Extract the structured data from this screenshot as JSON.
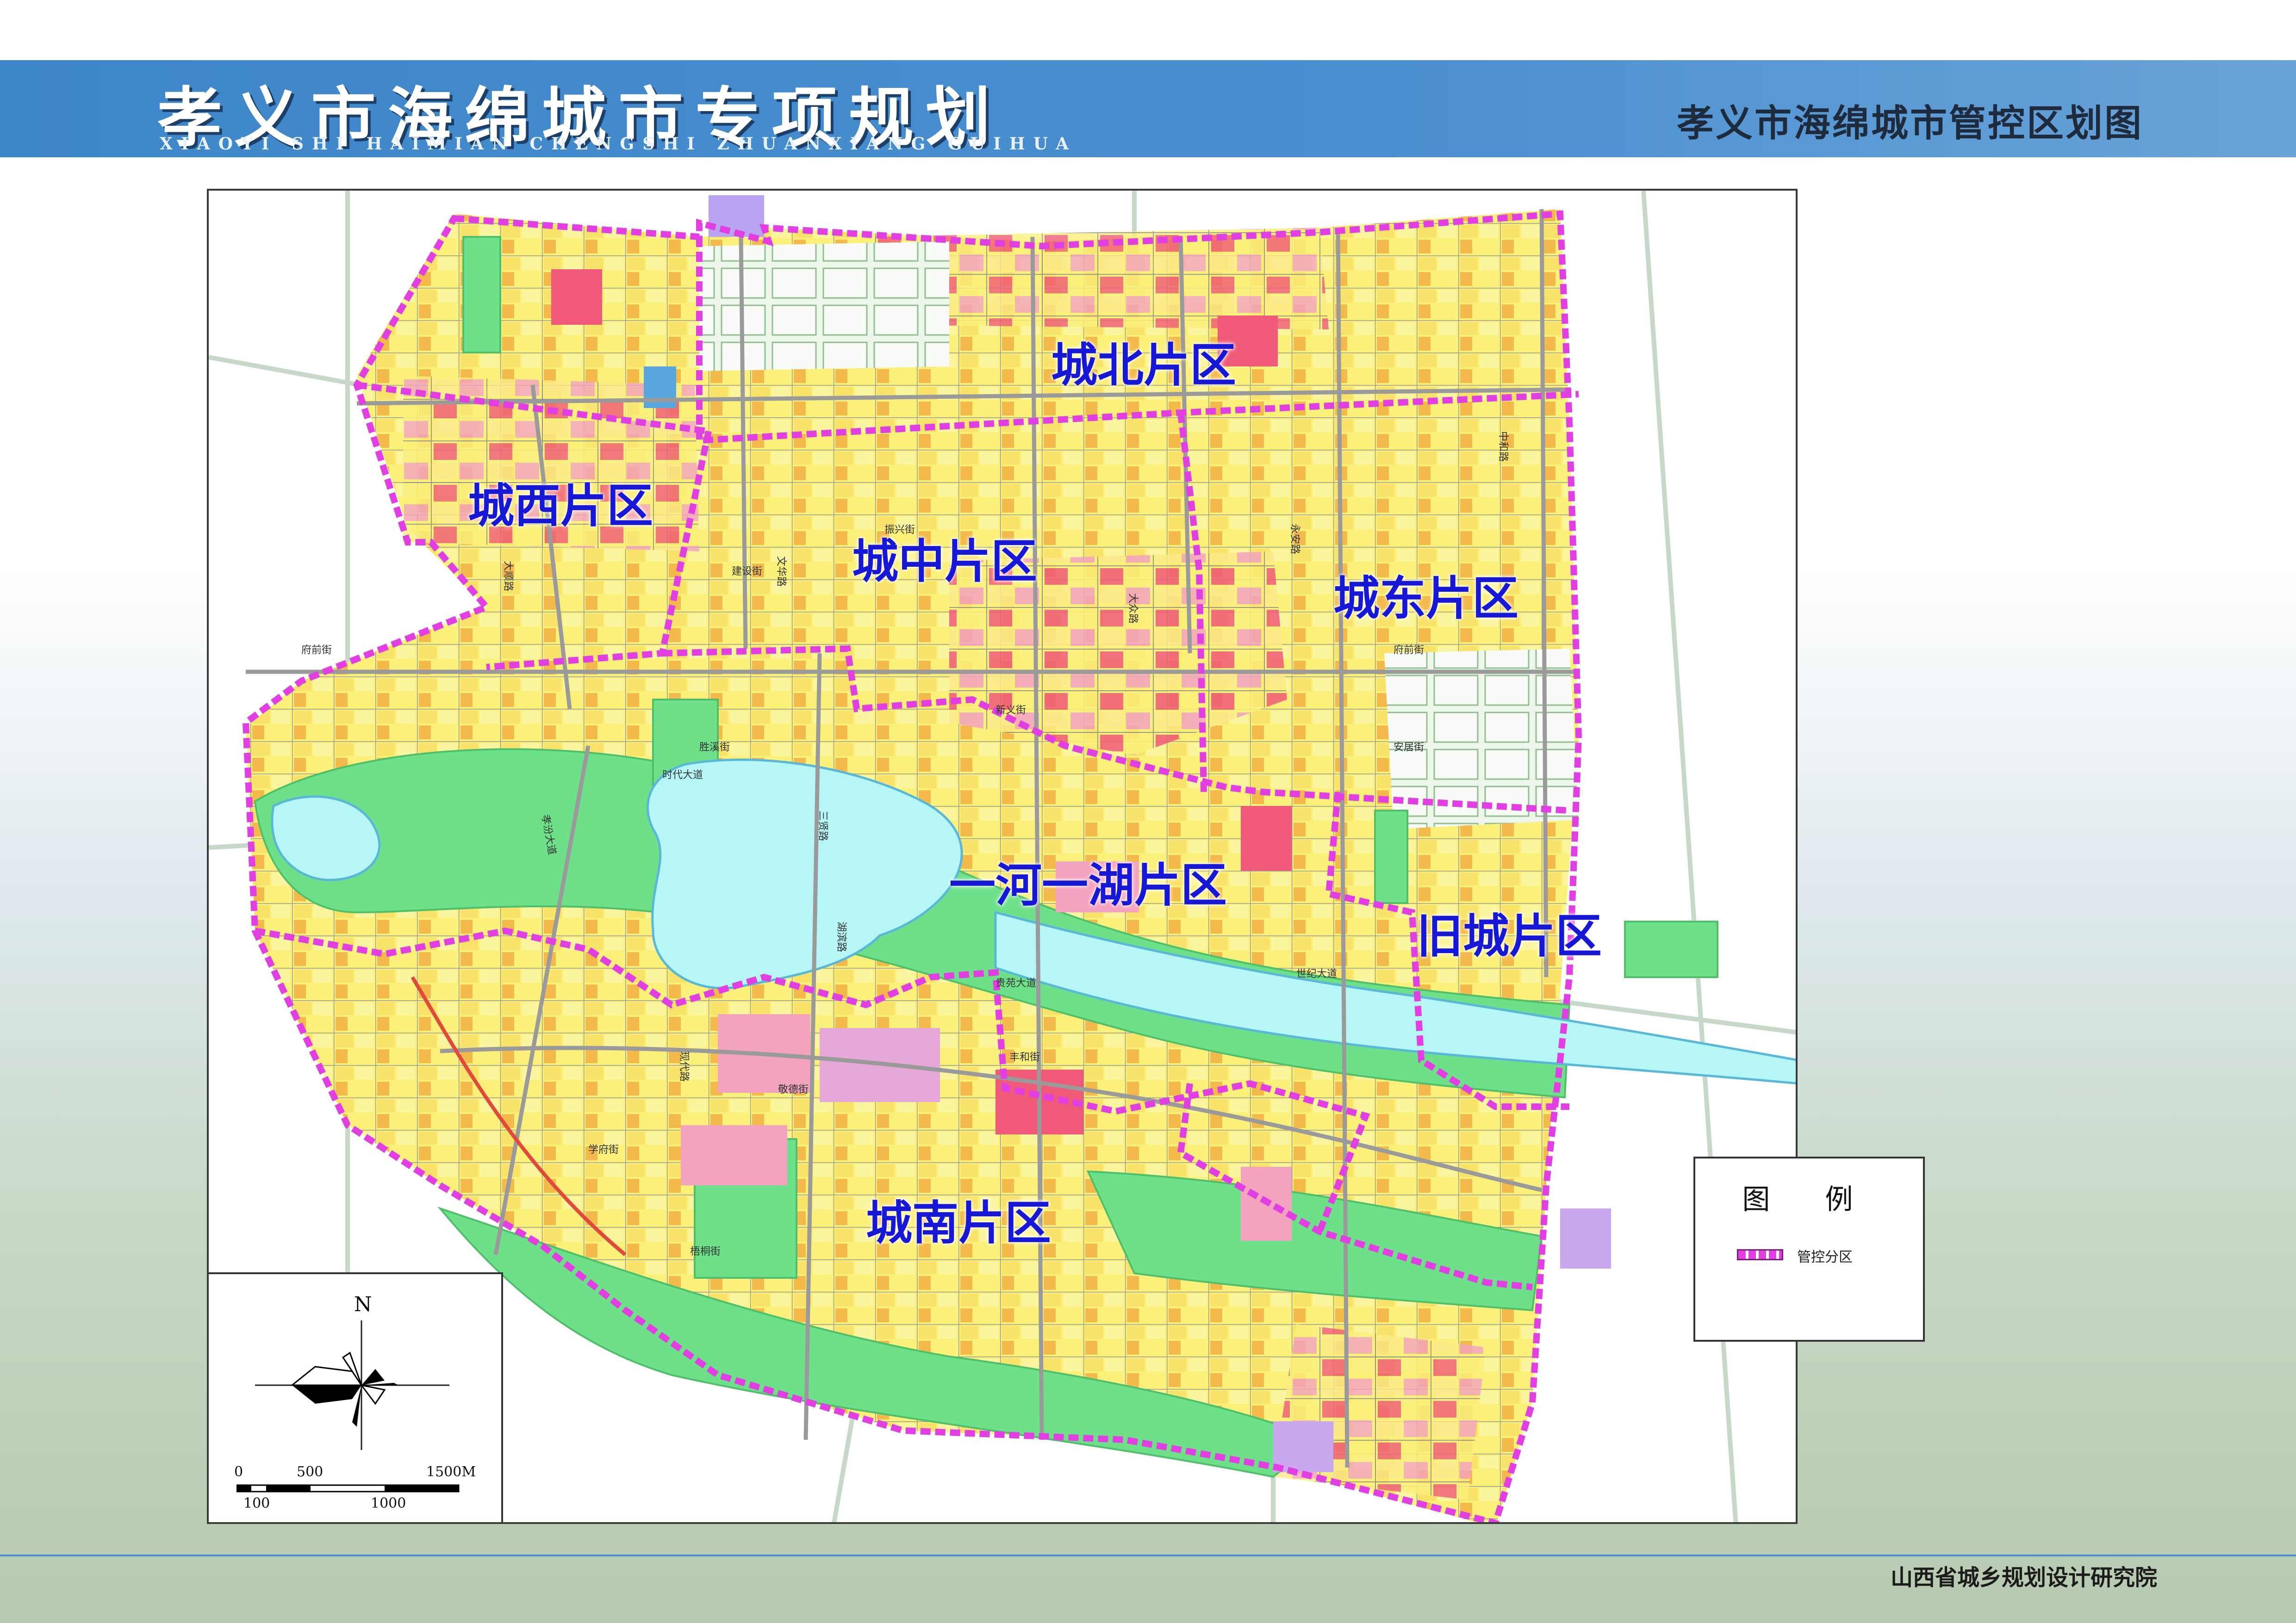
{
  "header": {
    "title": "孝义市海绵城市专项规划",
    "pinyin": "XIAOYI SHI  HAIMIAN  CHENGSHI  ZHUANXIANG  GUIHUA",
    "map_title": "孝义市海绵城市管控区划图"
  },
  "footer": {
    "institute": "山西省城乡规划设计研究院"
  },
  "colors": {
    "header_band": "#4a8fd0",
    "boundary": "#e13fe1",
    "label": "#1717d6",
    "green_space": "#6fe08a",
    "water": "#b6f6f6",
    "residential": "#fbf07a",
    "commercial": "#f05a78"
  },
  "districts": [
    {
      "id": "north",
      "label": "城北片区"
    },
    {
      "id": "west",
      "label": "城西片区"
    },
    {
      "id": "center",
      "label": "城中片区"
    },
    {
      "id": "east",
      "label": "城东片区"
    },
    {
      "id": "river_lake",
      "label": "一河一湖片区"
    },
    {
      "id": "old_city",
      "label": "旧城片区"
    },
    {
      "id": "south",
      "label": "城南片区"
    }
  ],
  "roads": [
    "府前街",
    "胜溪街",
    "时代大道",
    "孝汾大道",
    "湖滨路",
    "三贤路",
    "振兴街",
    "文华路",
    "建设街",
    "府前街",
    "新义街",
    "大众路",
    "永安路",
    "中和路",
    "安居街",
    "贵苑大道",
    "丰和街",
    "现代路",
    "学府街",
    "敬德街",
    "梧桐街",
    "世纪大道",
    "大顺路"
  ],
  "compass": {
    "north_label": "N",
    "icon": "compass-rose-icon"
  },
  "scale_bar": {
    "top_labels": [
      "0",
      "500",
      "1500M"
    ],
    "bottom_labels": [
      "100",
      "1000"
    ]
  },
  "legend": {
    "title": "图 例",
    "items": [
      {
        "label": "管控分区",
        "symbol": "dashed-boundary"
      }
    ]
  }
}
